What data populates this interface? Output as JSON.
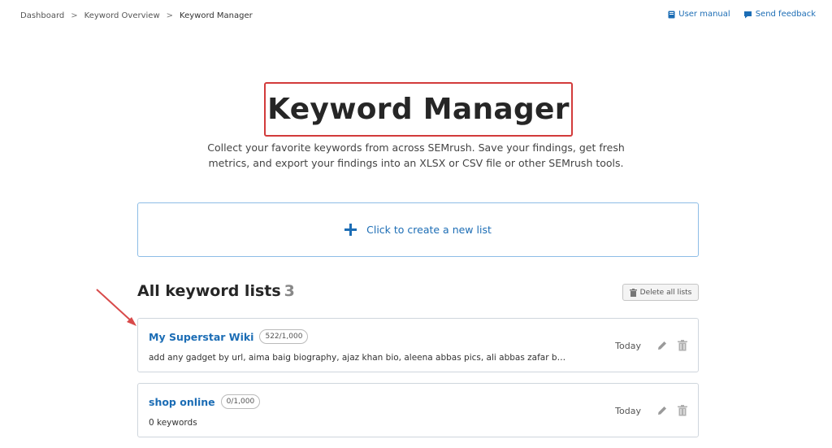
{
  "breadcrumb": {
    "items": [
      "Dashboard",
      "Keyword Overview",
      "Keyword Manager"
    ],
    "separator": ">"
  },
  "toplinks": {
    "user_manual": "User manual",
    "send_feedback": "Send feedback"
  },
  "header": {
    "title": "Keyword Manager",
    "subtitle_line1": "Collect your favorite keywords from across SEMrush. Save your findings, get fresh",
    "subtitle_line2": "metrics, and export your findings into an XLSX or CSV file or other SEMrush tools."
  },
  "create": {
    "label": "Click to create a new list"
  },
  "lists": {
    "heading": "All keyword lists",
    "count": "3",
    "delete_all_label": "Delete all lists",
    "items": [
      {
        "name": "My Superstar Wiki",
        "count": "522/1,000",
        "description": "add any gadget by url, aima baig biography, ajaz khan bio, aleena abbas pics, ali abbas zafar b…",
        "date": "Today"
      },
      {
        "name": "shop online",
        "count": "0/1,000",
        "description": "0 keywords",
        "date": "Today"
      }
    ]
  },
  "colors": {
    "accent": "#1c6db5",
    "highlight_border": "#d23b3b",
    "create_border": "#8dbde6"
  },
  "icons": {
    "user_manual": "book-icon",
    "send_feedback": "speech-bubble-icon",
    "create": "plus-icon",
    "delete_all": "trash-icon",
    "edit": "pencil-icon",
    "delete": "trash-icon",
    "annotation": "red-arrow-icon"
  }
}
